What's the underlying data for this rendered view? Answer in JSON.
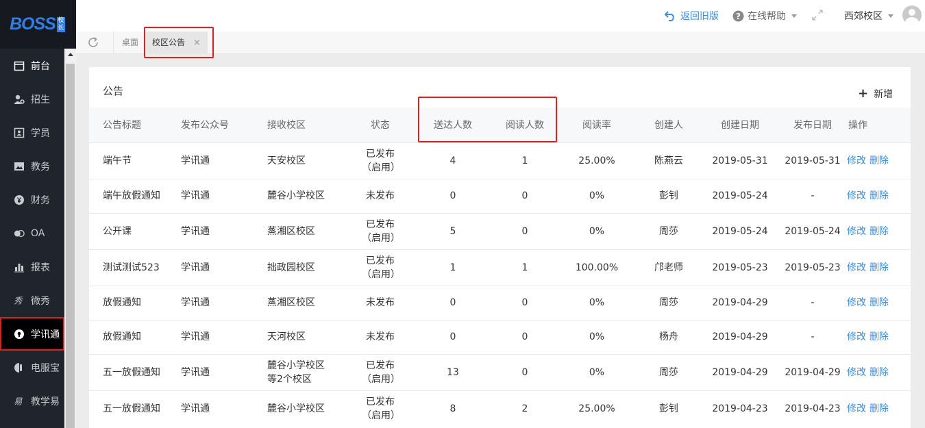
{
  "logo": {
    "text": "BOSS",
    "badge": "校长"
  },
  "sidebar": {
    "items": [
      {
        "label": "前台",
        "icon": "calendar-icon"
      },
      {
        "label": "招生",
        "icon": "user-add-icon"
      },
      {
        "label": "学员",
        "icon": "id-card-icon"
      },
      {
        "label": "教务",
        "icon": "image-icon"
      },
      {
        "label": "财务",
        "icon": "yen-icon"
      },
      {
        "label": "OA",
        "icon": "oa-icon"
      },
      {
        "label": "报表",
        "icon": "bar-chart-icon"
      },
      {
        "label": "微秀",
        "icon": "xiu-icon"
      },
      {
        "label": "学讯通",
        "icon": "location-icon"
      },
      {
        "label": "电服宝",
        "icon": "phone-icon"
      },
      {
        "label": "教学易",
        "icon": "teach-icon"
      }
    ]
  },
  "header": {
    "back_label": "返回旧版",
    "help_label": "在线帮助",
    "campus_label": "西郊校区"
  },
  "tabs": {
    "desk_label": "桌面",
    "active_label": "校区公告",
    "close_glyph": "×"
  },
  "panel": {
    "title": "公告",
    "add_label": "新增"
  },
  "table": {
    "headers": [
      "公告标题",
      "发布公众号",
      "接收校区",
      "状态",
      "送达人数",
      "阅读人数",
      "阅读率",
      "创建人",
      "创建日期",
      "发布日期",
      "操作"
    ],
    "rows": [
      {
        "title": "端午节",
        "account": "学讯通",
        "campus": "天安校区",
        "status": "已发布（启用）",
        "sent": "4",
        "read": "1",
        "rate": "25.00%",
        "creator": "陈燕云",
        "created": "2019-05-31",
        "published": "2019-05-31"
      },
      {
        "title": "端午放假通知",
        "account": "学讯通",
        "campus": "麓谷小学校区",
        "status": "未发布",
        "sent": "0",
        "read": "0",
        "rate": "0%",
        "creator": "彭钊",
        "created": "2019-05-24",
        "published": "-"
      },
      {
        "title": "公开课",
        "account": "学讯通",
        "campus": "蒸湘区校区",
        "status": "已发布（启用）",
        "sent": "5",
        "read": "0",
        "rate": "0%",
        "creator": "周莎",
        "created": "2019-05-24",
        "published": "2019-05-24"
      },
      {
        "title": "测试测试523",
        "account": "学讯通",
        "campus": "拙政园校区",
        "status": "已发布（启用）",
        "sent": "1",
        "read": "1",
        "rate": "100.00%",
        "creator": "邝老师",
        "created": "2019-05-23",
        "published": "2019-05-23"
      },
      {
        "title": "放假通知",
        "account": "学讯通",
        "campus": "蒸湘区校区",
        "status": "未发布",
        "sent": "0",
        "read": "0",
        "rate": "0%",
        "creator": "周莎",
        "created": "2019-04-29",
        "published": "-"
      },
      {
        "title": "放假通知",
        "account": "学讯通",
        "campus": "天河校区",
        "status": "未发布",
        "sent": "0",
        "read": "0",
        "rate": "0%",
        "creator": "杨舟",
        "created": "2019-04-29",
        "published": "-"
      },
      {
        "title": "五一放假通知",
        "account": "学讯通",
        "campus": "麓谷小学校区等2个校区",
        "status": "已发布（启用）",
        "sent": "13",
        "read": "0",
        "rate": "0%",
        "creator": "周莎",
        "created": "2019-04-29",
        "published": "2019-04-29"
      },
      {
        "title": "五一放假通知",
        "account": "学讯通",
        "campus": "麓谷小学校区",
        "status": "已发布（启用）",
        "sent": "8",
        "read": "2",
        "rate": "25.00%",
        "creator": "彭钊",
        "created": "2019-04-23",
        "published": "2019-04-23"
      }
    ],
    "edit_label": "修改",
    "delete_label": "删除"
  },
  "colors": {
    "accent": "#3a8ee6",
    "highlight": "#e0201f",
    "sidebar": "#20242c"
  }
}
